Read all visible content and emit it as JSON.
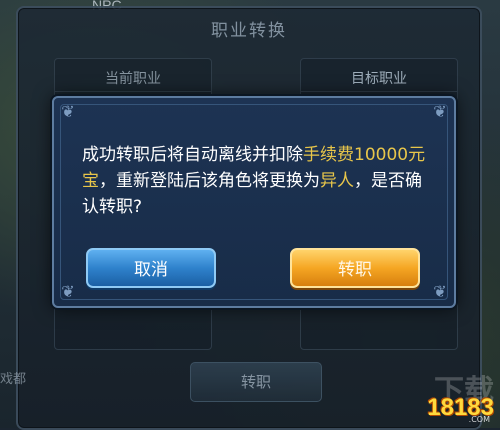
{
  "scene": {
    "npc_tag": "NPC",
    "side_text": "戏都"
  },
  "panel": {
    "title": "职业转换",
    "current_label": "当前职业",
    "target_label": "目标职业",
    "button_label": "转职"
  },
  "dialog": {
    "msg_part1": "成功转职后将自动离线并扣除",
    "msg_fee": "手续费10000元宝",
    "msg_part2": "，重新登陆后该角色将更换为",
    "msg_class": "异人",
    "msg_part3": "，是否确认转职?",
    "cancel_label": "取消",
    "confirm_label": "转职",
    "highlight_color": "#e8c64a"
  },
  "watermark": {
    "top": "下载",
    "logo": "18183",
    "sub": ".COM"
  }
}
